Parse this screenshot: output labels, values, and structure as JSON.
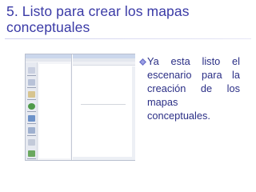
{
  "slide": {
    "title": "5. Listo para crear los mapas conceptuales",
    "bullet": "Ya esta listo el escenario para la creación de los mapas conceptuales.",
    "bullet_icon": "diamond-bullet-icon",
    "colors": {
      "title": "#3a3aa6",
      "text": "#2b2f86",
      "bullet": "#6b6fc9"
    }
  },
  "screenshot": {
    "tool_icons": [
      "tool-icon",
      "tool-icon",
      "tool-icon",
      "tool-icon",
      "tool-icon",
      "tool-icon",
      "tool-icon",
      "tool-icon",
      "tool-icon"
    ]
  }
}
